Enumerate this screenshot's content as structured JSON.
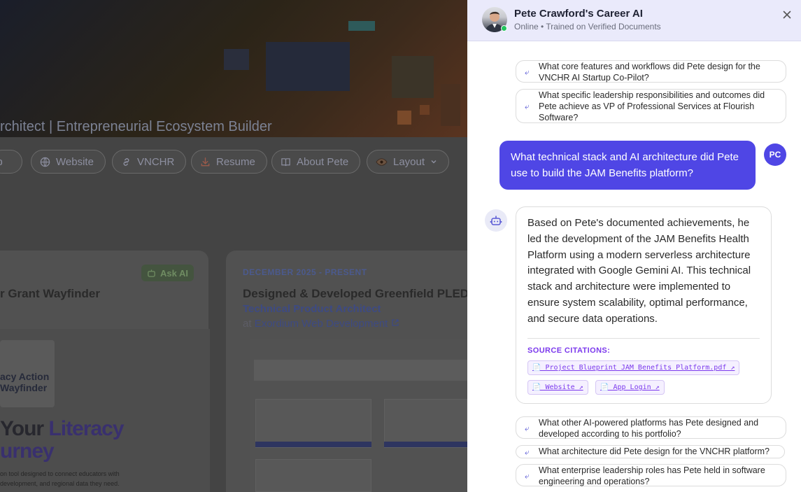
{
  "background": {
    "hero_title": "rchitect | Entrepreneurial Ecosystem Builder",
    "nav": [
      {
        "label": "ub",
        "icon": "github-icon"
      },
      {
        "label": "Website",
        "icon": "globe-icon"
      },
      {
        "label": "VNCHR",
        "icon": "link-icon"
      },
      {
        "label": "Resume",
        "icon": "download-icon"
      },
      {
        "label": "About Pete",
        "icon": "book-icon"
      },
      {
        "label": "Layout",
        "icon": "eye-icon"
      }
    ],
    "card1": {
      "ask_ai": "Ask AI",
      "title": "r Grant Wayfinder",
      "logo_text_1": "acy Action",
      "logo_text_2": "Wayfinder",
      "hero_line_1a": "Your ",
      "hero_line_1b": "Literacy",
      "hero_line_2": "urney",
      "caption_1": "on tool designed to connect educators with",
      "caption_2": "development, and regional data they need."
    },
    "card2": {
      "date": "DECEMBER 2025 - PRESENT",
      "title": "Designed & Developed Greenfield PLEDGE",
      "role": "Technical Product Architect",
      "company_prefix": "at ",
      "company": "Exordium Web Development"
    }
  },
  "chat": {
    "title": "Pete Crawford's Career AI",
    "subtitle": "Online • Trained on Verified Documents",
    "top_suggestions": [
      "What core features and workflows did Pete design for the VNCHR AI Startup Co-Pilot?",
      "What specific leadership responsibilities and outcomes did Pete achieve as VP of Professional Services at Flourish Software?"
    ],
    "user_message": "What technical stack and AI architecture did Pete use to build the JAM Benefits platform?",
    "user_initials": "PC",
    "bot_message": "Based on Pete's documented achievements, he led the development of the JAM Benefits Health Platform using a modern serverless architecture integrated with Google Gemini AI. This technical stack and architecture were implemented to ensure system scalability, optimal performance, and secure data operations.",
    "citations_label": "SOURCE CITATIONS:",
    "citations": [
      "📄 Project Blueprint  JAM Benefits Platform.pdf ↗",
      "📄 Website ↗",
      "📄 App Login ↗"
    ],
    "bottom_suggestions": [
      "What other AI-powered platforms has Pete designed and developed according to his portfolio?",
      "What architecture did Pete design for the VNCHR platform?",
      "What enterprise leadership roles has Pete held in software engineering and operations?"
    ]
  }
}
